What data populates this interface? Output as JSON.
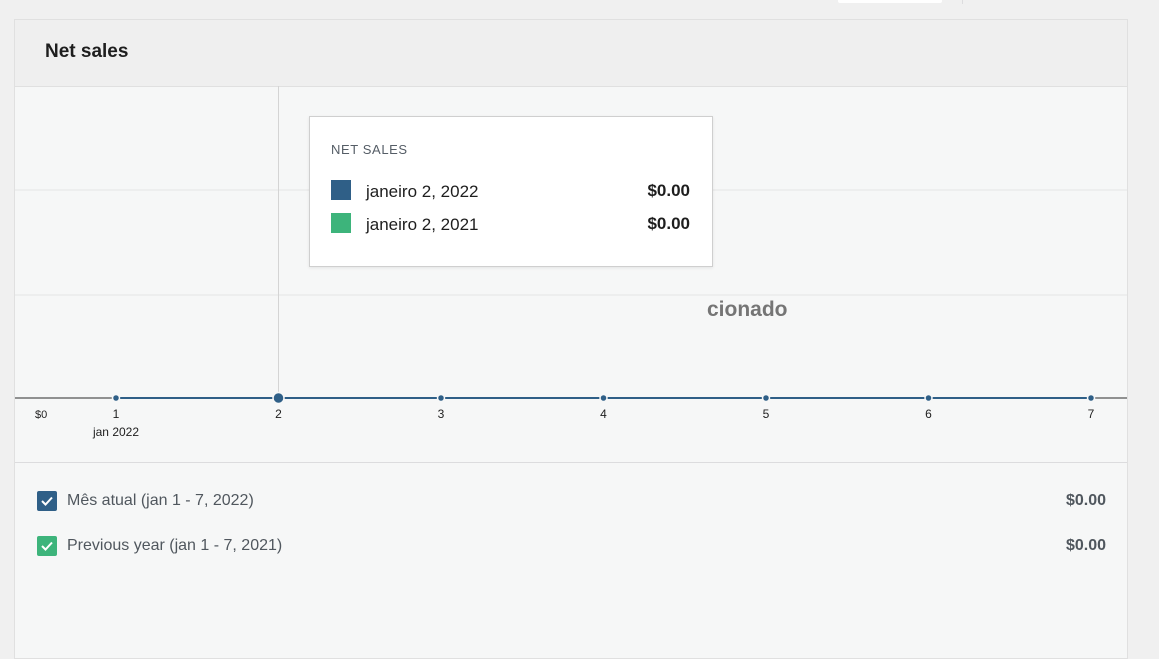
{
  "card": {
    "title": "Net sales"
  },
  "empty_message": "cionado",
  "tooltip": {
    "title": "NET SALES",
    "rows": [
      {
        "label": "janeiro 2, 2022",
        "value": "$0.00",
        "color": "#2f5f87"
      },
      {
        "label": "janeiro 2, 2021",
        "value": "$0.00",
        "color": "#3db47b"
      }
    ]
  },
  "legend": [
    {
      "label": "Mês atual (jan 1 - 7, 2022)",
      "value": "$0.00",
      "color": "#2f5f87",
      "checked": true
    },
    {
      "label": "Previous year (jan 1 - 7, 2021)",
      "value": "$0.00",
      "color": "#3db47b",
      "checked": true
    }
  ],
  "chart_data": {
    "type": "line",
    "title": "Net sales",
    "x": [
      "1",
      "2",
      "3",
      "4",
      "5",
      "6",
      "7"
    ],
    "x_secondary_label": "jan 2022",
    "y_tick_labels": [
      "$0"
    ],
    "ylim": [
      0,
      0
    ],
    "grid": true,
    "highlighted_index": 1,
    "series": [
      {
        "name": "Mês atual (jan 1 - 7, 2022)",
        "values": [
          0,
          0,
          0,
          0,
          0,
          0,
          0
        ],
        "color": "#2f5f87"
      },
      {
        "name": "Previous year (jan 1 - 7, 2021)",
        "values": [
          0,
          0,
          0,
          0,
          0,
          0,
          0
        ],
        "color": "#3db47b"
      }
    ]
  }
}
